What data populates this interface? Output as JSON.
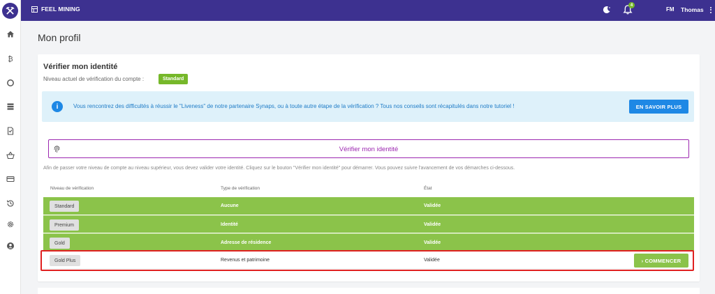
{
  "app": {
    "brand": "FEEL MINING",
    "notifications_count": "4",
    "user_initials": "FM",
    "user_name": "Thomas"
  },
  "sidebar": {
    "items": [
      {
        "icon": "home-icon"
      },
      {
        "icon": "bitcoin-icon"
      },
      {
        "icon": "circle-icon"
      },
      {
        "icon": "server-icon"
      },
      {
        "icon": "document-icon"
      },
      {
        "icon": "basket-icon"
      },
      {
        "icon": "credit-card-icon"
      },
      {
        "icon": "history-icon"
      },
      {
        "icon": "gear-icon"
      },
      {
        "icon": "user-circle-icon"
      }
    ]
  },
  "page": {
    "title": "Mon profil"
  },
  "verify": {
    "title": "Vérifier mon identité",
    "level_label": "Niveau actuel de vérification du compte :",
    "current_level": "Standard",
    "info_text": "Vous rencontrez des difficultés à réussir le \"Liveness\" de notre partenaire Synaps, ou à toute autre étape de la vérification ? Tous nos conseils sont récapitulés dans notre tutoriel !",
    "learn_more": "EN SAVOIR PLUS",
    "verify_button": "Vérifier mon identité",
    "help_text": "Afin de passer votre niveau de compte au niveau supérieur, vous devez valider votre identité. Cliquez sur le bouton \"Vérifier mon identité\" pour démarrer. Vous pouvez suivre l'avancement de vos démarches ci-dessous."
  },
  "table": {
    "headers": [
      "Niveau de vérification",
      "Type de vérification",
      "État"
    ],
    "rows": [
      {
        "level": "Standard",
        "type": "Aucune",
        "state": "Validée"
      },
      {
        "level": "Premium",
        "type": "Identité",
        "state": "Validée"
      },
      {
        "level": "Gold",
        "type": "Adresse de résidence",
        "state": "Validée"
      },
      {
        "level": "Gold Plus",
        "type": "Revenus et patrimoine",
        "state": "Validée",
        "action": "› COMMENCER"
      }
    ]
  },
  "colors": {
    "primary": "#3d3190",
    "green": "#8bc34a",
    "badge_green": "#76b82a",
    "info_blue": "#1e88e5",
    "purple": "#9c27b0",
    "highlight_red": "#e02020"
  }
}
